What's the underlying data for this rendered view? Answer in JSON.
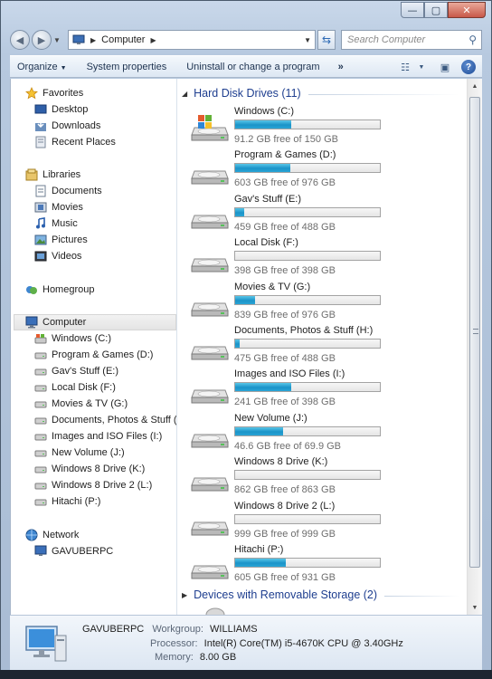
{
  "window": {
    "caption_buttons": {
      "minimize": "—",
      "maximize": "▢",
      "close": "✕"
    }
  },
  "address_bar": {
    "crumb": "Computer",
    "search_placeholder": "Search Computer"
  },
  "toolbar": {
    "organize": "Organize",
    "system_properties": "System properties",
    "uninstall": "Uninstall or change a program",
    "more": "»"
  },
  "nav": {
    "favorites": {
      "label": "Favorites",
      "items": [
        {
          "label": "Desktop"
        },
        {
          "label": "Downloads"
        },
        {
          "label": "Recent Places"
        }
      ]
    },
    "libraries": {
      "label": "Libraries",
      "items": [
        {
          "label": "Documents"
        },
        {
          "label": "Movies"
        },
        {
          "label": "Music"
        },
        {
          "label": "Pictures"
        },
        {
          "label": "Videos"
        }
      ]
    },
    "homegroup": {
      "label": "Homegroup"
    },
    "computer": {
      "label": "Computer",
      "items": [
        {
          "label": "Windows (C:)"
        },
        {
          "label": "Program & Games (D:)"
        },
        {
          "label": "Gav's Stuff (E:)"
        },
        {
          "label": "Local Disk (F:)"
        },
        {
          "label": "Movies & TV (G:)"
        },
        {
          "label": "Documents, Photos & Stuff (H:)"
        },
        {
          "label": "Images and ISO Files (I:)"
        },
        {
          "label": "New Volume (J:)"
        },
        {
          "label": "Windows 8 Drive (K:)"
        },
        {
          "label": "Windows 8 Drive 2 (L:)"
        },
        {
          "label": "Hitachi (P:)"
        }
      ]
    },
    "network": {
      "label": "Network",
      "items": [
        {
          "label": "GAVUBERPC"
        }
      ]
    }
  },
  "content": {
    "hdd_header": "Hard Disk Drives (11)",
    "removable_header": "Devices with Removable Storage (2)",
    "drives": [
      {
        "name": "Windows (C:)",
        "free": "91.2 GB free of 150 GB",
        "used_fraction": 0.39,
        "system": true
      },
      {
        "name": "Program & Games (D:)",
        "free": "603 GB free of 976 GB",
        "used_fraction": 0.38
      },
      {
        "name": "Gav's Stuff (E:)",
        "free": "459 GB free of 488 GB",
        "used_fraction": 0.06
      },
      {
        "name": "Local Disk (F:)",
        "free": "398 GB free of 398 GB",
        "used_fraction": 0.0
      },
      {
        "name": "Movies & TV (G:)",
        "free": "839 GB free of 976 GB",
        "used_fraction": 0.14
      },
      {
        "name": "Documents, Photos & Stuff (H:)",
        "free": "475 GB free of 488 GB",
        "used_fraction": 0.03
      },
      {
        "name": "Images and ISO Files (I:)",
        "free": "241 GB free of 398 GB",
        "used_fraction": 0.39
      },
      {
        "name": "New Volume (J:)",
        "free": "46.6 GB free of 69.9 GB",
        "used_fraction": 0.33
      },
      {
        "name": "Windows 8 Drive (K:)",
        "free": "862 GB free of 863 GB",
        "used_fraction": 0.0
      },
      {
        "name": "Windows 8 Drive 2 (L:)",
        "free": "999 GB free of 999 GB",
        "used_fraction": 0.0
      },
      {
        "name": "Hitachi (P:)",
        "free": "605 GB free of 931 GB",
        "used_fraction": 0.35
      }
    ]
  },
  "details": {
    "computer_name": "GAVUBERPC",
    "workgroup_label": "Workgroup:",
    "workgroup": "WILLIAMS",
    "processor_label": "Processor:",
    "processor": "Intel(R) Core(TM) i5-4670K CPU @ 3.40GHz",
    "memory_label": "Memory:",
    "memory": "8.00 GB"
  },
  "colors": {
    "accent_header": "#1e3e8f",
    "bar_fill": "#1b93c8"
  }
}
